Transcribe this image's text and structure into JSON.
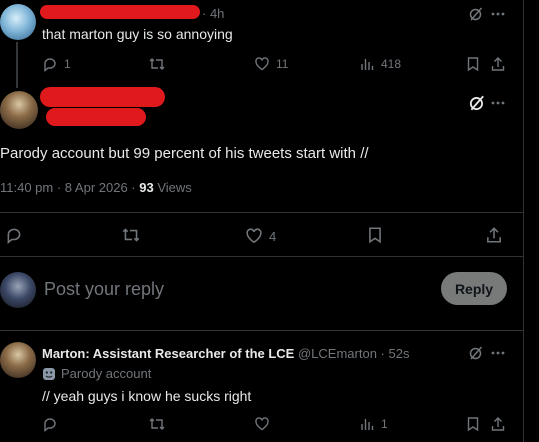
{
  "tweet1": {
    "time": "· 4h",
    "text": "that marton guy is so annoying",
    "replies": "1",
    "likes": "11",
    "views": "418"
  },
  "main": {
    "text": "Parody account but 99 percent of his tweets start with //",
    "timestamp": "11:40 pm · 8 Apr 2026 ·",
    "views_count": "93",
    "views_label": "Views",
    "likes": "4"
  },
  "reply_box": {
    "placeholder": "Post your reply",
    "button": "Reply"
  },
  "tweet3": {
    "name": "Marton: Assistant Researcher of the LCE",
    "handle": "@LCEmarton · 52s",
    "badge": "Parody account",
    "text": "// yeah guys i know he sucks right",
    "views": "1"
  },
  "colors": {
    "background": "#000000",
    "text": "#e7e9ea",
    "muted": "#71767b",
    "redaction": "#e0191c",
    "reply_button": "#787a7a"
  }
}
